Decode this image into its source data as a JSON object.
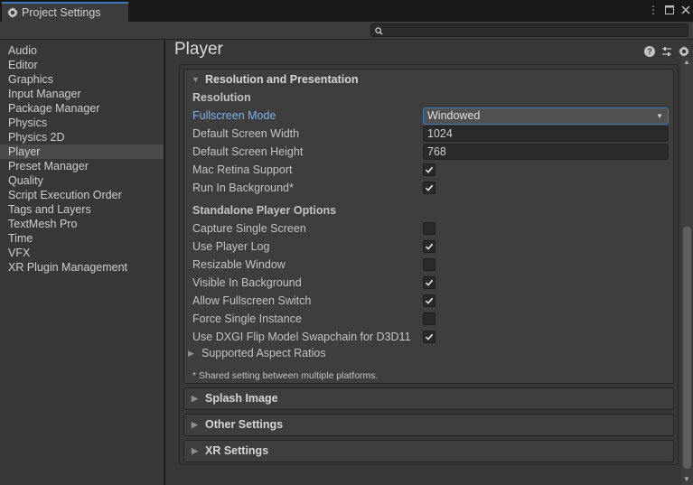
{
  "window": {
    "tab_title": "Project Settings",
    "menu_icon": "kebab-menu-icon",
    "maximize_icon": "maximize-icon",
    "close_icon": "close-icon"
  },
  "search": {
    "placeholder": "",
    "value": ""
  },
  "sidebar": {
    "items": [
      {
        "label": "Audio"
      },
      {
        "label": "Editor"
      },
      {
        "label": "Graphics"
      },
      {
        "label": "Input Manager"
      },
      {
        "label": "Package Manager"
      },
      {
        "label": "Physics"
      },
      {
        "label": "Physics 2D"
      },
      {
        "label": "Player"
      },
      {
        "label": "Preset Manager"
      },
      {
        "label": "Quality"
      },
      {
        "label": "Script Execution Order"
      },
      {
        "label": "Tags and Layers"
      },
      {
        "label": "TextMesh Pro"
      },
      {
        "label": "Time"
      },
      {
        "label": "VFX"
      },
      {
        "label": "XR Plugin Management"
      }
    ],
    "selected": "Player"
  },
  "main": {
    "title": "Player",
    "sections": {
      "resolution_presentation": {
        "title": "Resolution and Presentation",
        "resolution_header": "Resolution",
        "fullscreen_mode_label": "Fullscreen Mode",
        "fullscreen_mode_value": "Windowed",
        "default_width_label": "Default Screen Width",
        "default_width_value": "1024",
        "default_height_label": "Default Screen Height",
        "default_height_value": "768",
        "mac_retina_label": "Mac Retina Support",
        "mac_retina_checked": true,
        "run_bg_label": "Run In Background*",
        "run_bg_checked": true,
        "standalone_header": "Standalone Player Options",
        "capture_single_label": "Capture Single Screen",
        "capture_single_checked": false,
        "use_player_log_label": "Use Player Log",
        "use_player_log_checked": true,
        "resizable_label": "Resizable Window",
        "resizable_checked": false,
        "visible_bg_label": "Visible In Background",
        "visible_bg_checked": true,
        "allow_fullscreen_label": "Allow Fullscreen Switch",
        "allow_fullscreen_checked": true,
        "force_single_label": "Force Single Instance",
        "force_single_checked": false,
        "dxgi_label": "Use DXGI Flip Model Swapchain for D3D11",
        "dxgi_checked": true,
        "aspect_ratios_label": "Supported Aspect Ratios",
        "note": "* Shared setting between multiple platforms."
      },
      "splash_image": {
        "title": "Splash Image"
      },
      "other_settings": {
        "title": "Other Settings"
      },
      "xr_settings": {
        "title": "XR Settings"
      }
    }
  }
}
